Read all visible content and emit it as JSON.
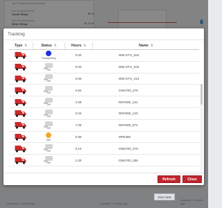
{
  "background": {
    "rows": [
      {
        "small": "Up: Requirements selected",
        "strong": "",
        "right": ""
      },
      {
        "small": "Out Requirements",
        "strong": "South Stimp",
        "right": "$2 ●"
      },
      {
        "small": "Out Requirements",
        "strong": "Week Stimp",
        "right": "$1.25 ●"
      }
    ],
    "footer_left": "Updated: 1 minute ago",
    "footer_mid": "Updated: 1 minute ago",
    "footer_right": "Updated: 1 minute ago",
    "view_carts_label": "View Carts"
  },
  "modal": {
    "title": "Tracking",
    "columns": [
      {
        "label": "Type",
        "sort": "⇅"
      },
      {
        "label": "Status",
        "sort": "⇅"
      },
      {
        "label": "Hours",
        "sort": "⇅"
      },
      {
        "label": "Name",
        "sort": "⇅"
      }
    ],
    "rows": [
      {
        "status_kind": "dot",
        "status_color": "#1f2ee0",
        "status_label": "Transporting",
        "hours": "0.00",
        "name": "WM-GTX_024"
      },
      {
        "status_kind": "box",
        "status_color": "#d3d3d3",
        "status_label": "Off",
        "hours": "0.00",
        "name": "WM-GTX_023"
      },
      {
        "status_kind": "box",
        "status_color": "#d3d3d3",
        "status_label": "Off",
        "hours": "0.00",
        "name": "WM-GTX_213"
      },
      {
        "status_kind": "box",
        "status_color": "#d3d3d3",
        "status_label": "Off",
        "hours": "4.54",
        "name": "GM4700_278"
      },
      {
        "status_kind": "box",
        "status_color": "#d3d3d3",
        "status_label": "Off",
        "hours": "4.28",
        "name": "RM7000_121"
      },
      {
        "status_kind": "box",
        "status_color": "#d3d3d3",
        "status_label": "Off",
        "hours": "3.04",
        "name": "RM7000_123"
      },
      {
        "status_kind": "box",
        "status_color": "#d3d3d3",
        "status_label": "Off",
        "hours": "7.08",
        "name": "RM7000_871"
      },
      {
        "status_kind": "dot",
        "status_color": "#f0a830",
        "status_label": "Idle",
        "hours": "0.90",
        "name": "MP5480"
      },
      {
        "status_kind": "box",
        "status_color": "#d3d3d3",
        "status_label": "Off",
        "hours": "0.10",
        "name": "GM4700_279"
      },
      {
        "status_kind": "box",
        "status_color": "#d3d3d3",
        "status_label": "Off",
        "hours": "1.20",
        "name": "GM4700_255"
      }
    ],
    "refresh_label": "Refresh",
    "close_label": "Close"
  },
  "colors": {
    "accent": "#c0262d",
    "transporting": "#1f2ee0",
    "idle": "#f0a830"
  }
}
